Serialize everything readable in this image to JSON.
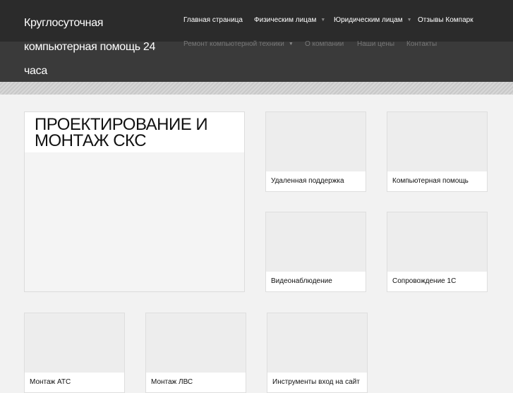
{
  "site": {
    "title": "Круглосуточная компьютерная помощь 24 часа"
  },
  "nav": {
    "row1": [
      {
        "label": "Главная страница",
        "has_dropdown": false
      },
      {
        "label": "Физическим лицам",
        "has_dropdown": true
      },
      {
        "label": "Юридическим лицам",
        "has_dropdown": true
      },
      {
        "label": "Отзывы Компарк",
        "has_dropdown": false
      }
    ],
    "row2": [
      {
        "label": "Ремонт компьютерной техники",
        "has_dropdown": true
      },
      {
        "label": "О компании",
        "has_dropdown": false
      },
      {
        "label": "Наши цены",
        "has_dropdown": false
      },
      {
        "label": "Контакты",
        "has_dropdown": false
      }
    ]
  },
  "feature": {
    "title": "ПРОЕКТИРОВАНИЕ И МОНТАЖ СКС"
  },
  "cards": [
    {
      "label": "Удаленная поддержка"
    },
    {
      "label": "Компьютерная помощь"
    },
    {
      "label": "Видеонаблюдение"
    },
    {
      "label": "Сопровождение 1С"
    },
    {
      "label": "Монтаж АТС"
    },
    {
      "label": "Монтаж ЛВС"
    },
    {
      "label": "Инструменты вход на сайт"
    }
  ]
}
